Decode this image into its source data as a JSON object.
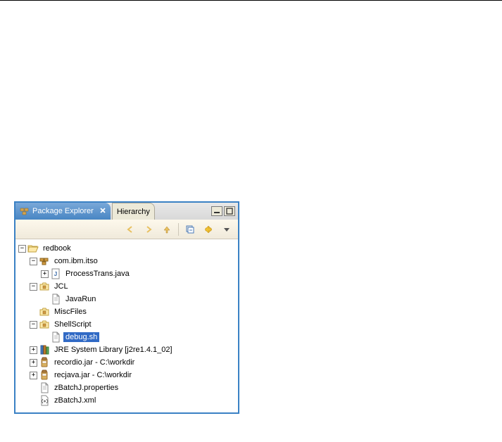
{
  "tabs": {
    "active": "Package Explorer",
    "inactive": "Hierarchy"
  },
  "tree": {
    "project": "redbook",
    "pkg_com_ibm_itso": "com.ibm.itso",
    "process_trans": "ProcessTrans.java",
    "jcl": "JCL",
    "javarun": "JavaRun",
    "miscfiles": "MiscFiles",
    "shellscript": "ShellScript",
    "debug_sh": "debug.sh",
    "jre": "JRE System Library [j2re1.4.1_02]",
    "recordio": "recordio.jar - C:\\workdir",
    "recjava": "recjava.jar - C:\\workdir",
    "zbatchj_props": "zBatchJ.properties",
    "zbatchj_xml": "zBatchJ.xml"
  }
}
